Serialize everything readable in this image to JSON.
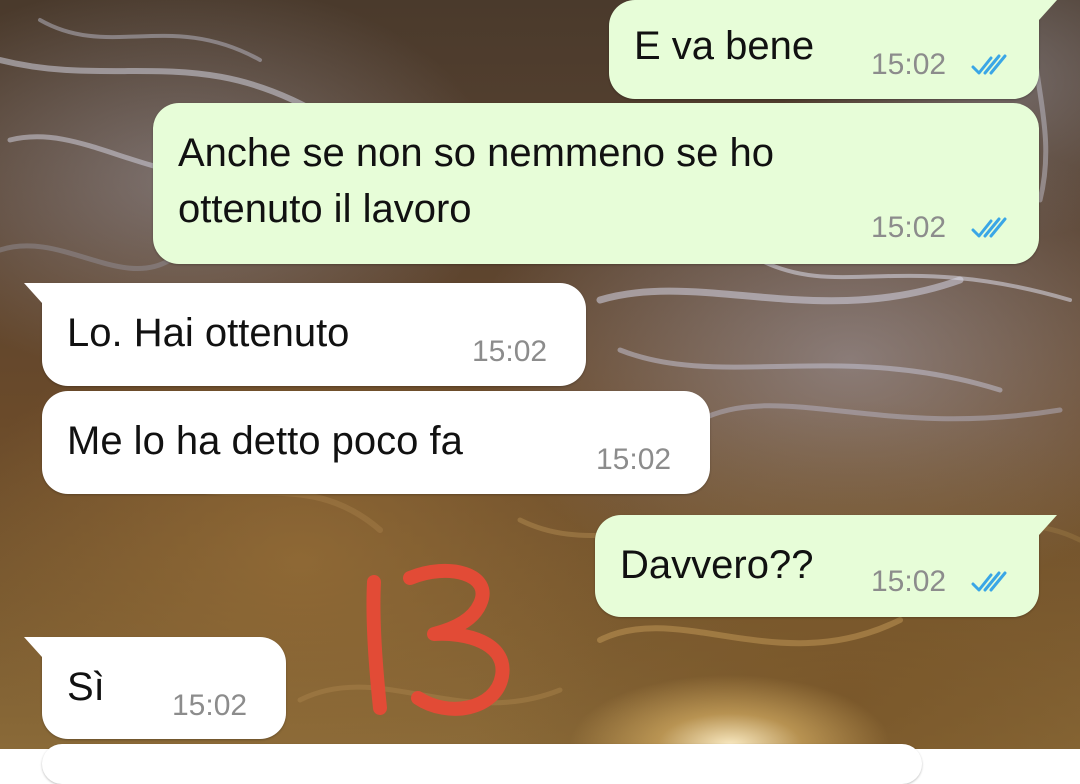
{
  "chat": {
    "messages": [
      {
        "direction": "outgoing",
        "text": "E va bene",
        "time": "15:02",
        "status": "read-double-check"
      },
      {
        "direction": "outgoing",
        "text": "Anche se non so nemmeno se ho\nottenuto il lavoro",
        "time": "15:02",
        "status": "read-double-check"
      },
      {
        "direction": "incoming",
        "text": "Lo. Hai ottenuto",
        "time": "15:02"
      },
      {
        "direction": "incoming",
        "text": "Me lo ha detto poco fa",
        "time": "15:02"
      },
      {
        "direction": "outgoing",
        "text": "Davvero??",
        "time": "15:02",
        "status": "read-double-check"
      },
      {
        "direction": "incoming",
        "text": "Sì",
        "time": "15:02"
      }
    ]
  },
  "overlay": {
    "annotation": "13",
    "color": "#e24b36"
  },
  "colors": {
    "outgoing_bubble": "#e7fdd8",
    "incoming_bubble": "#ffffff",
    "read_ticks": "#3aa6e6",
    "timestamp": "#8c8c8c"
  },
  "icons": {
    "read_status": "double-check-icon"
  }
}
